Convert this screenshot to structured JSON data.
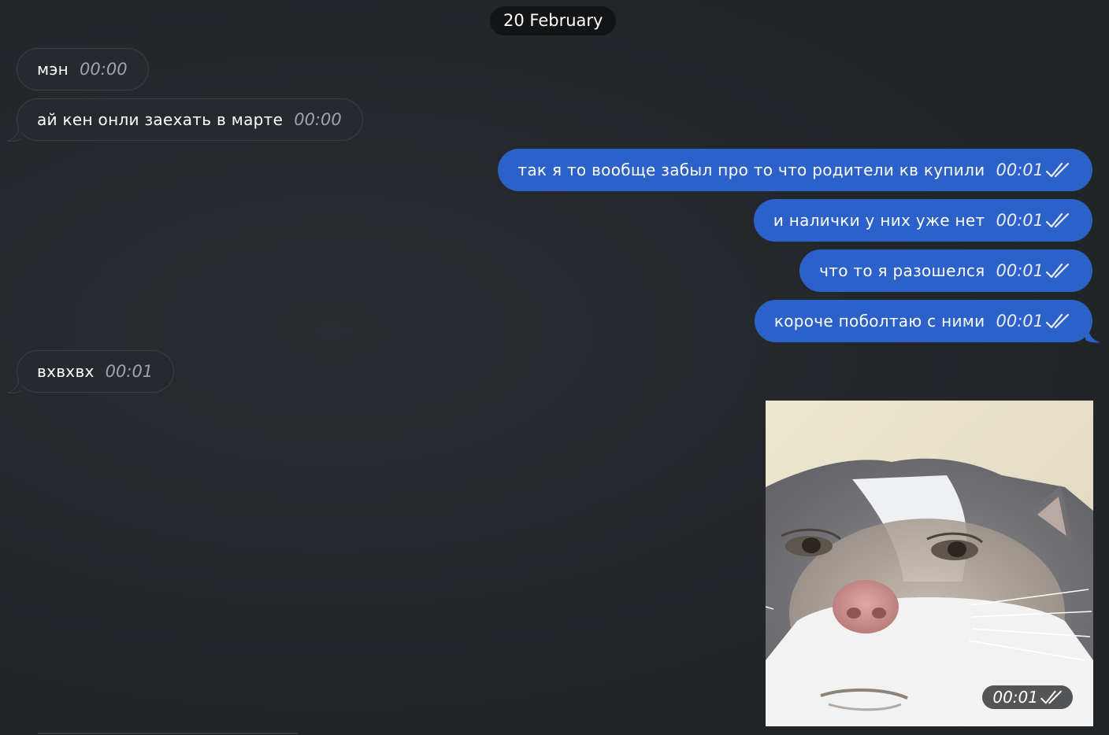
{
  "date_separator": "20 February",
  "messages": [
    {
      "direction": "in",
      "text": "мэн",
      "time": "00:00"
    },
    {
      "direction": "in",
      "text": "ай кен онли заехать в марте",
      "time": "00:00"
    },
    {
      "direction": "out",
      "text": "так я то вообще забыл про то что родители кв купили",
      "time": "00:01",
      "status": "read"
    },
    {
      "direction": "out",
      "text": "и налички у них уже нет",
      "time": "00:01",
      "status": "read"
    },
    {
      "direction": "out",
      "text": "что то я разошелся",
      "time": "00:01",
      "status": "read"
    },
    {
      "direction": "out",
      "text": "короче поболтаю с ними",
      "time": "00:01",
      "status": "read"
    },
    {
      "direction": "in",
      "text": "вхвхвх",
      "time": "00:01"
    }
  ],
  "photo_message": {
    "direction": "out",
    "content": "photo of a cat with a human face",
    "time": "00:01",
    "status": "read"
  },
  "colors": {
    "background": "#23262a",
    "incoming_bubble": "#26292d",
    "outgoing_bubble": "#2c61c9",
    "date_pill": "#121416"
  },
  "icons": {
    "read_status": "double-check-icon"
  }
}
